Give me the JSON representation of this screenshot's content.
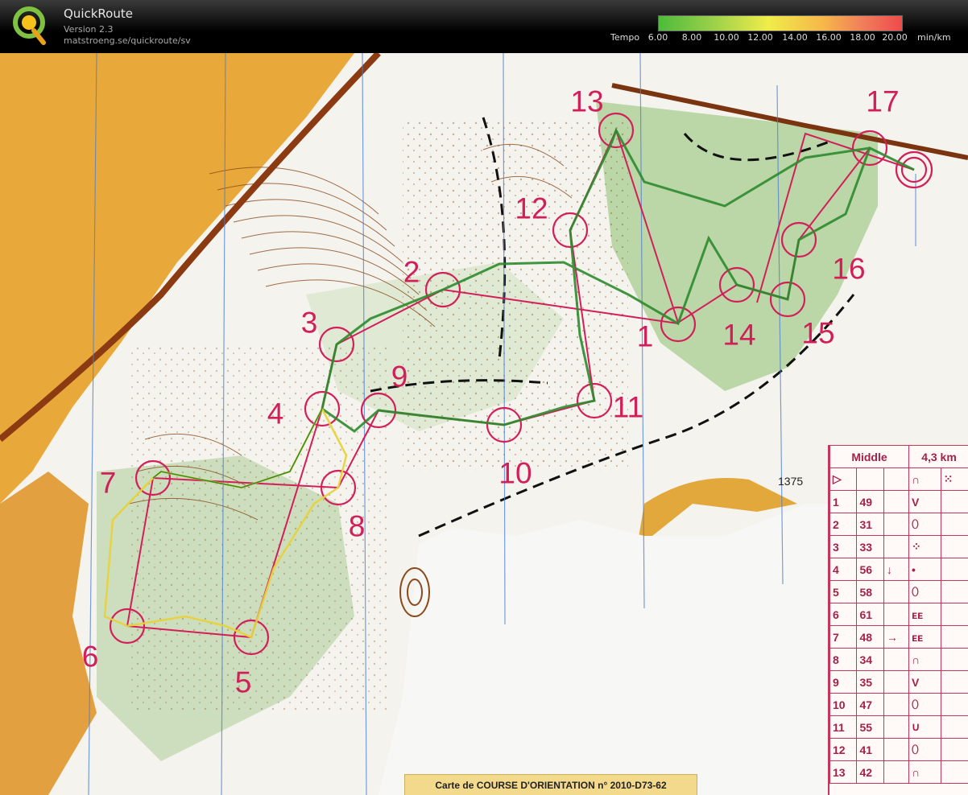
{
  "app": {
    "name": "QuickRoute",
    "version": "Version 2.3",
    "url": "matstroeng.se/quickroute/sv"
  },
  "legend": {
    "title": "Tempo",
    "ticks": [
      "6.00",
      "8.00",
      "10.00",
      "12.00",
      "14.00",
      "16.00",
      "18.00",
      "20.00"
    ],
    "unit": "min/km",
    "colors": [
      "#4dbb3a",
      "#9ad04a",
      "#f0ec4a",
      "#f6b64a",
      "#f07a5a",
      "#ef4a4a"
    ]
  },
  "map": {
    "spot_height": "1375",
    "footer": "Carte de COURSE D'ORIENTATION n° 2010-D73-62",
    "controls": [
      "1",
      "2",
      "3",
      "4",
      "5",
      "6",
      "7",
      "8",
      "9",
      "10",
      "11",
      "12",
      "13",
      "14",
      "15",
      "16",
      "17"
    ],
    "course_color": "#d21f5a",
    "route_color": "#2e8b2e"
  },
  "descriptions": {
    "class": "Middle",
    "length": "4,3 km",
    "rows": [
      {
        "n": "1",
        "code": "49",
        "dir": "",
        "sym": "V"
      },
      {
        "n": "2",
        "code": "31",
        "dir": "",
        "sym": "⬯"
      },
      {
        "n": "3",
        "code": "33",
        "dir": "",
        "sym": "⁘"
      },
      {
        "n": "4",
        "code": "56",
        "dir": "↓",
        "sym": "•"
      },
      {
        "n": "5",
        "code": "58",
        "dir": "",
        "sym": "⬯"
      },
      {
        "n": "6",
        "code": "61",
        "dir": "",
        "sym": "ᴇᴇ"
      },
      {
        "n": "7",
        "code": "48",
        "dir": "→",
        "sym": "ᴇᴇ"
      },
      {
        "n": "8",
        "code": "34",
        "dir": "",
        "sym": "∩"
      },
      {
        "n": "9",
        "code": "35",
        "dir": "",
        "sym": "V"
      },
      {
        "n": "10",
        "code": "47",
        "dir": "",
        "sym": "⬯"
      },
      {
        "n": "11",
        "code": "55",
        "dir": "",
        "sym": "∪"
      },
      {
        "n": "12",
        "code": "41",
        "dir": "",
        "sym": "⬯"
      },
      {
        "n": "13",
        "code": "42",
        "dir": "",
        "sym": "∩"
      }
    ]
  }
}
